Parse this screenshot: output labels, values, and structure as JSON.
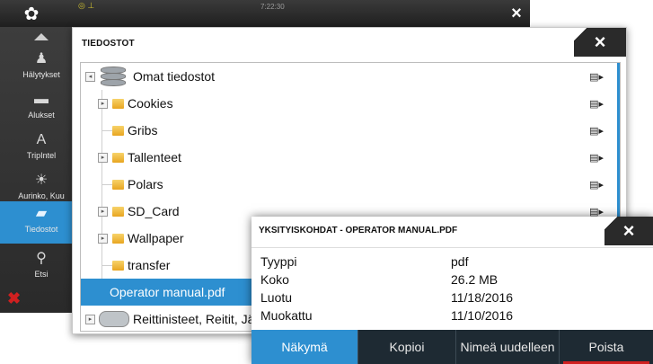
{
  "topbar": {
    "time": "7:22:30",
    "close_glyph": "×"
  },
  "sidebar": {
    "items": [
      {
        "label": "Hälytykset",
        "icon": "bell-icon"
      },
      {
        "label": "Alukset",
        "icon": "vessels-icon"
      },
      {
        "label": "TripIntel",
        "icon": "tripintel-icon"
      },
      {
        "label": "Aurinko, Kuu",
        "icon": "sun-moon-icon"
      },
      {
        "label": "Tiedostot",
        "icon": "folder-icon"
      },
      {
        "label": "Etsi",
        "icon": "search-icon"
      }
    ],
    "active_index": 4,
    "accent": "#2d8fd0",
    "close_color": "#d02020"
  },
  "files": {
    "title": "TIEDOSTOT",
    "close_glyph": "×",
    "root": "Omat tiedostot",
    "items": [
      {
        "label": "Cookies",
        "expandable": true
      },
      {
        "label": "Gribs",
        "expandable": false
      },
      {
        "label": "Tallenteet",
        "expandable": true
      },
      {
        "label": "Polars",
        "expandable": false
      },
      {
        "label": "SD_Card",
        "expandable": true
      },
      {
        "label": "Wallpaper",
        "expandable": true
      },
      {
        "label": "transfer",
        "expandable": false
      }
    ],
    "selected": "Operator manual.pdf",
    "bottom": "Reittinisteet, Reitit, Jäliet"
  },
  "details": {
    "title": "YKSITYISKOHDAT - OPERATOR MANUAL.PDF",
    "close_glyph": "×",
    "rows": [
      {
        "key": "Tyyppi",
        "value": "pdf"
      },
      {
        "key": "Koko",
        "value": "26.2 MB"
      },
      {
        "key": "Luotu",
        "value": "11/18/2016"
      },
      {
        "key": "Muokattu",
        "value": "11/10/2016"
      }
    ],
    "buttons": [
      "Näkymä",
      "Kopioi",
      "Nimeä uudelleen",
      "Poista"
    ]
  }
}
